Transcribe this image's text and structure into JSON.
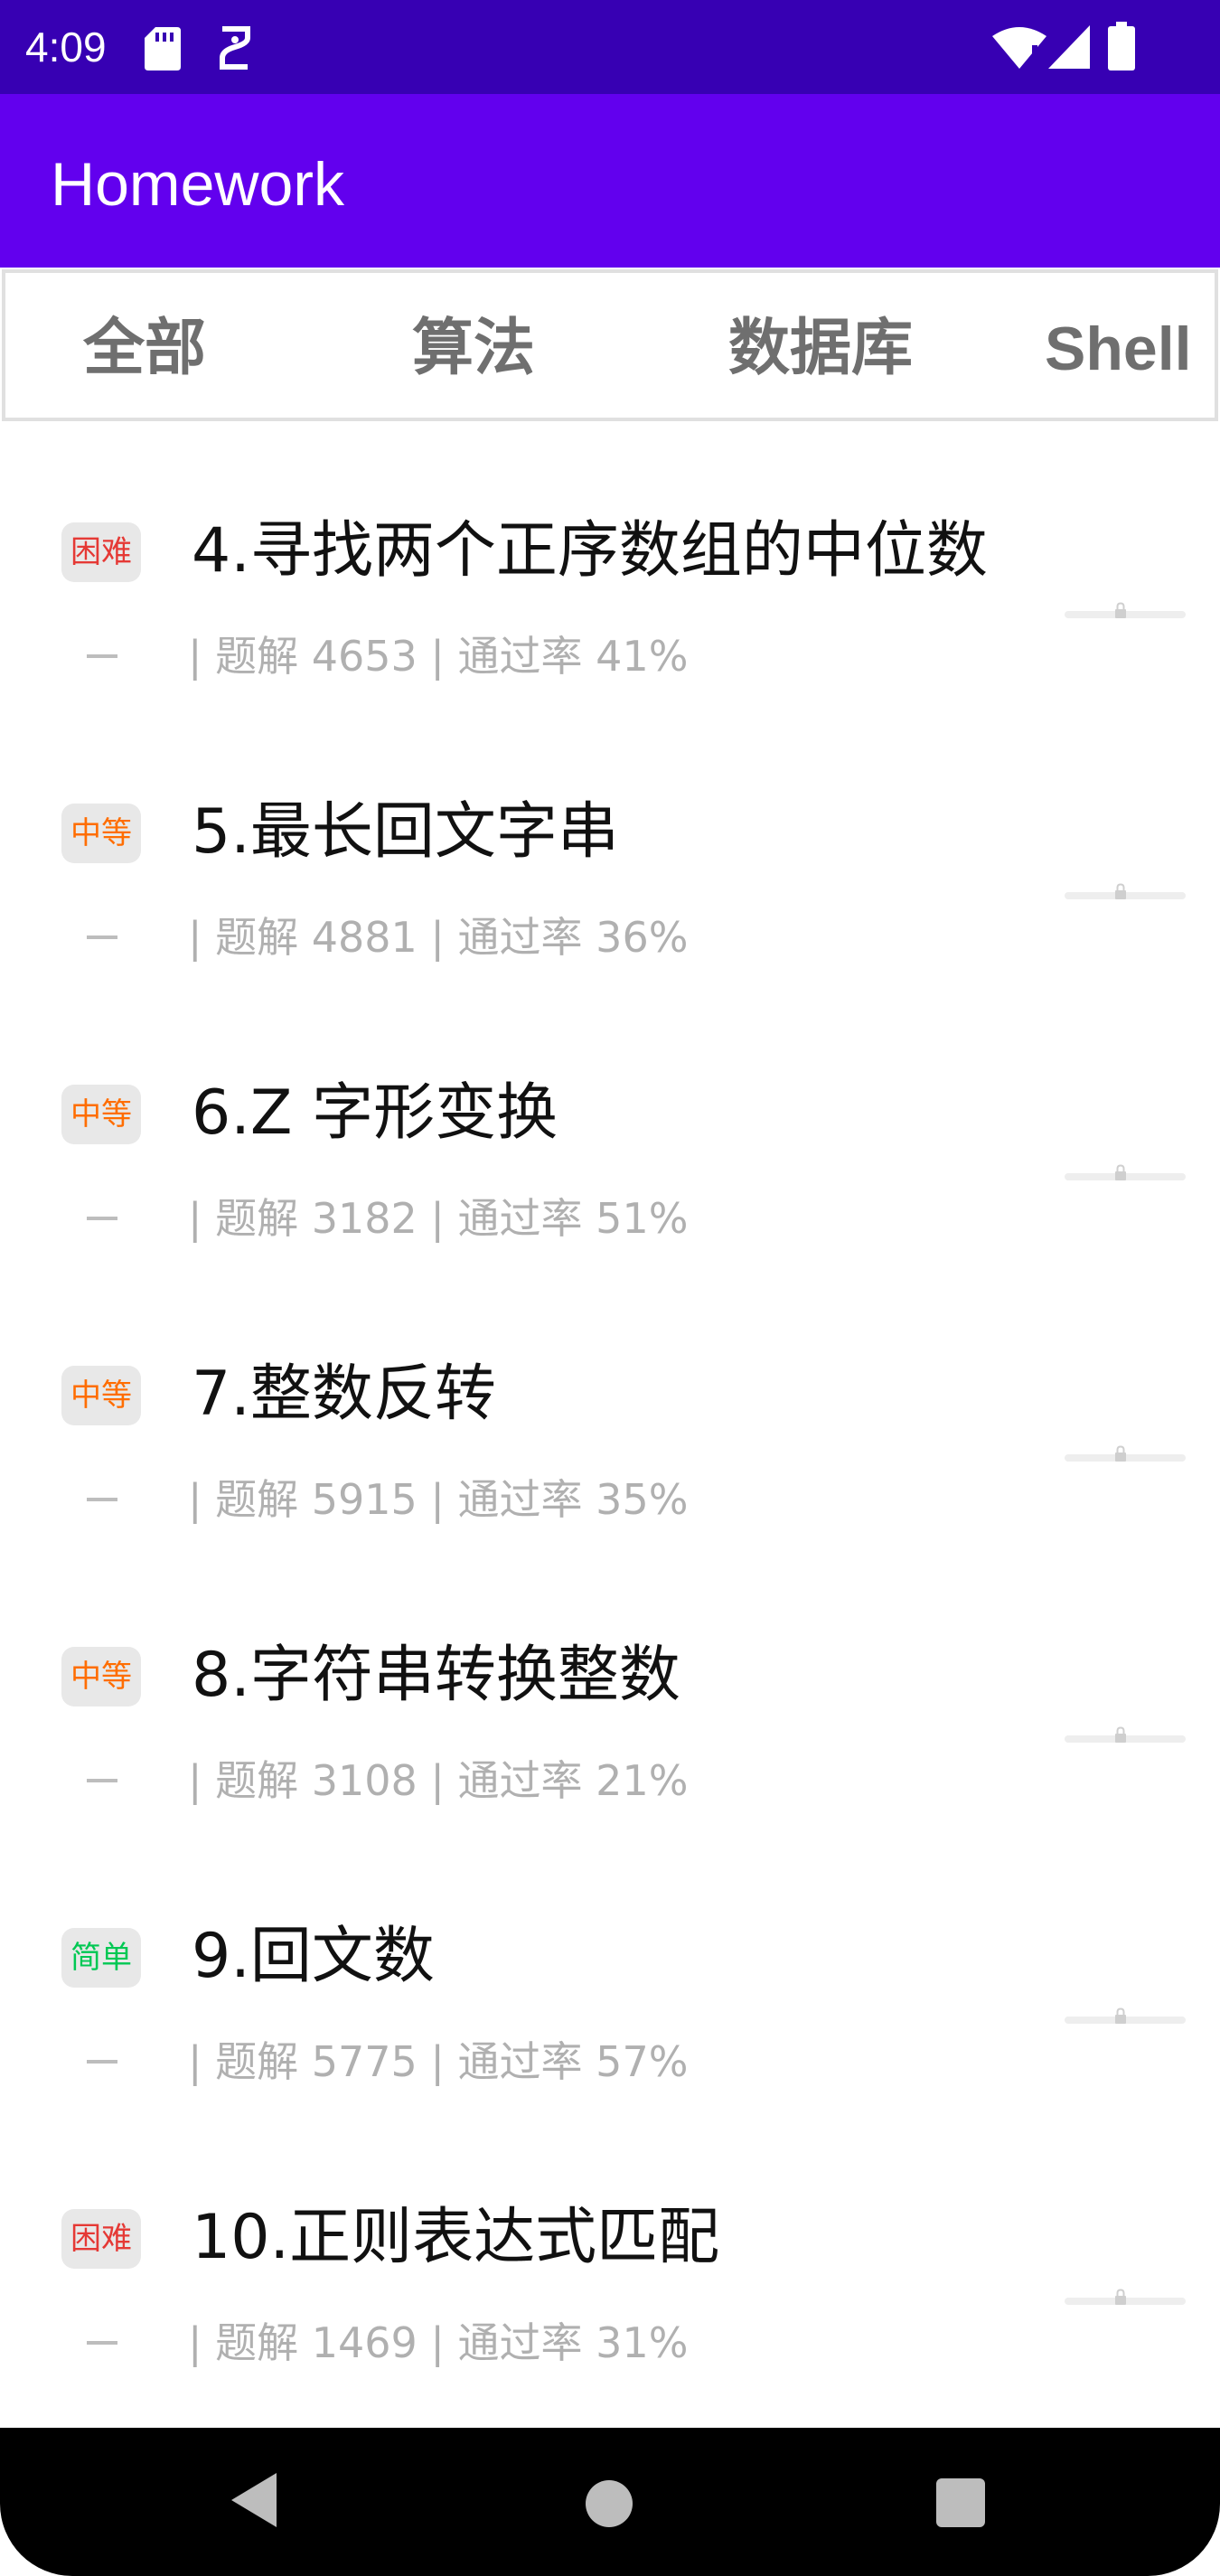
{
  "status_bar": {
    "time": "4:09",
    "icons": [
      "sd-card-icon",
      "assistant-icon",
      "wifi-icon",
      "signal-icon",
      "battery-icon"
    ],
    "background": "#3700b3"
  },
  "app_bar": {
    "title": "Homework",
    "background": "#6200ee"
  },
  "tabs": [
    {
      "label": "全部"
    },
    {
      "label": "算法"
    },
    {
      "label": "数据库"
    },
    {
      "label": "Shell"
    }
  ],
  "difficulty_colors": {
    "困难": "#e53935",
    "中等": "#ff6d00",
    "简单": "#00c853"
  },
  "problems": [
    {
      "difficulty": "困难",
      "title": "4.寻找两个正序数组的中位数",
      "status": "—",
      "meta": "| 题解 4653  |  通过率 41%",
      "locked": true
    },
    {
      "difficulty": "中等",
      "title": "5.最长回文字串",
      "status": "—",
      "meta": "| 题解 4881  |  通过率 36%",
      "locked": true
    },
    {
      "difficulty": "中等",
      "title": "6.Z 字形变换",
      "status": "—",
      "meta": "| 题解 3182  |  通过率 51%",
      "locked": true
    },
    {
      "difficulty": "中等",
      "title": "7.整数反转",
      "status": "—",
      "meta": "| 题解 5915  |  通过率 35%",
      "locked": true
    },
    {
      "difficulty": "中等",
      "title": "8.字符串转换整数",
      "status": "—",
      "meta": "| 题解 3108  |  通过率 21%",
      "locked": true
    },
    {
      "difficulty": "简单",
      "title": "9.回文数",
      "status": "—",
      "meta": "| 题解 5775  |  通过率 57%",
      "locked": true
    },
    {
      "difficulty": "困难",
      "title": "10.正则表达式匹配",
      "status": "—",
      "meta": "| 题解 1469  |  通过率 31%",
      "locked": true
    }
  ],
  "nav_bar": {
    "icons": [
      "back-icon",
      "home-icon",
      "recents-icon"
    ]
  }
}
